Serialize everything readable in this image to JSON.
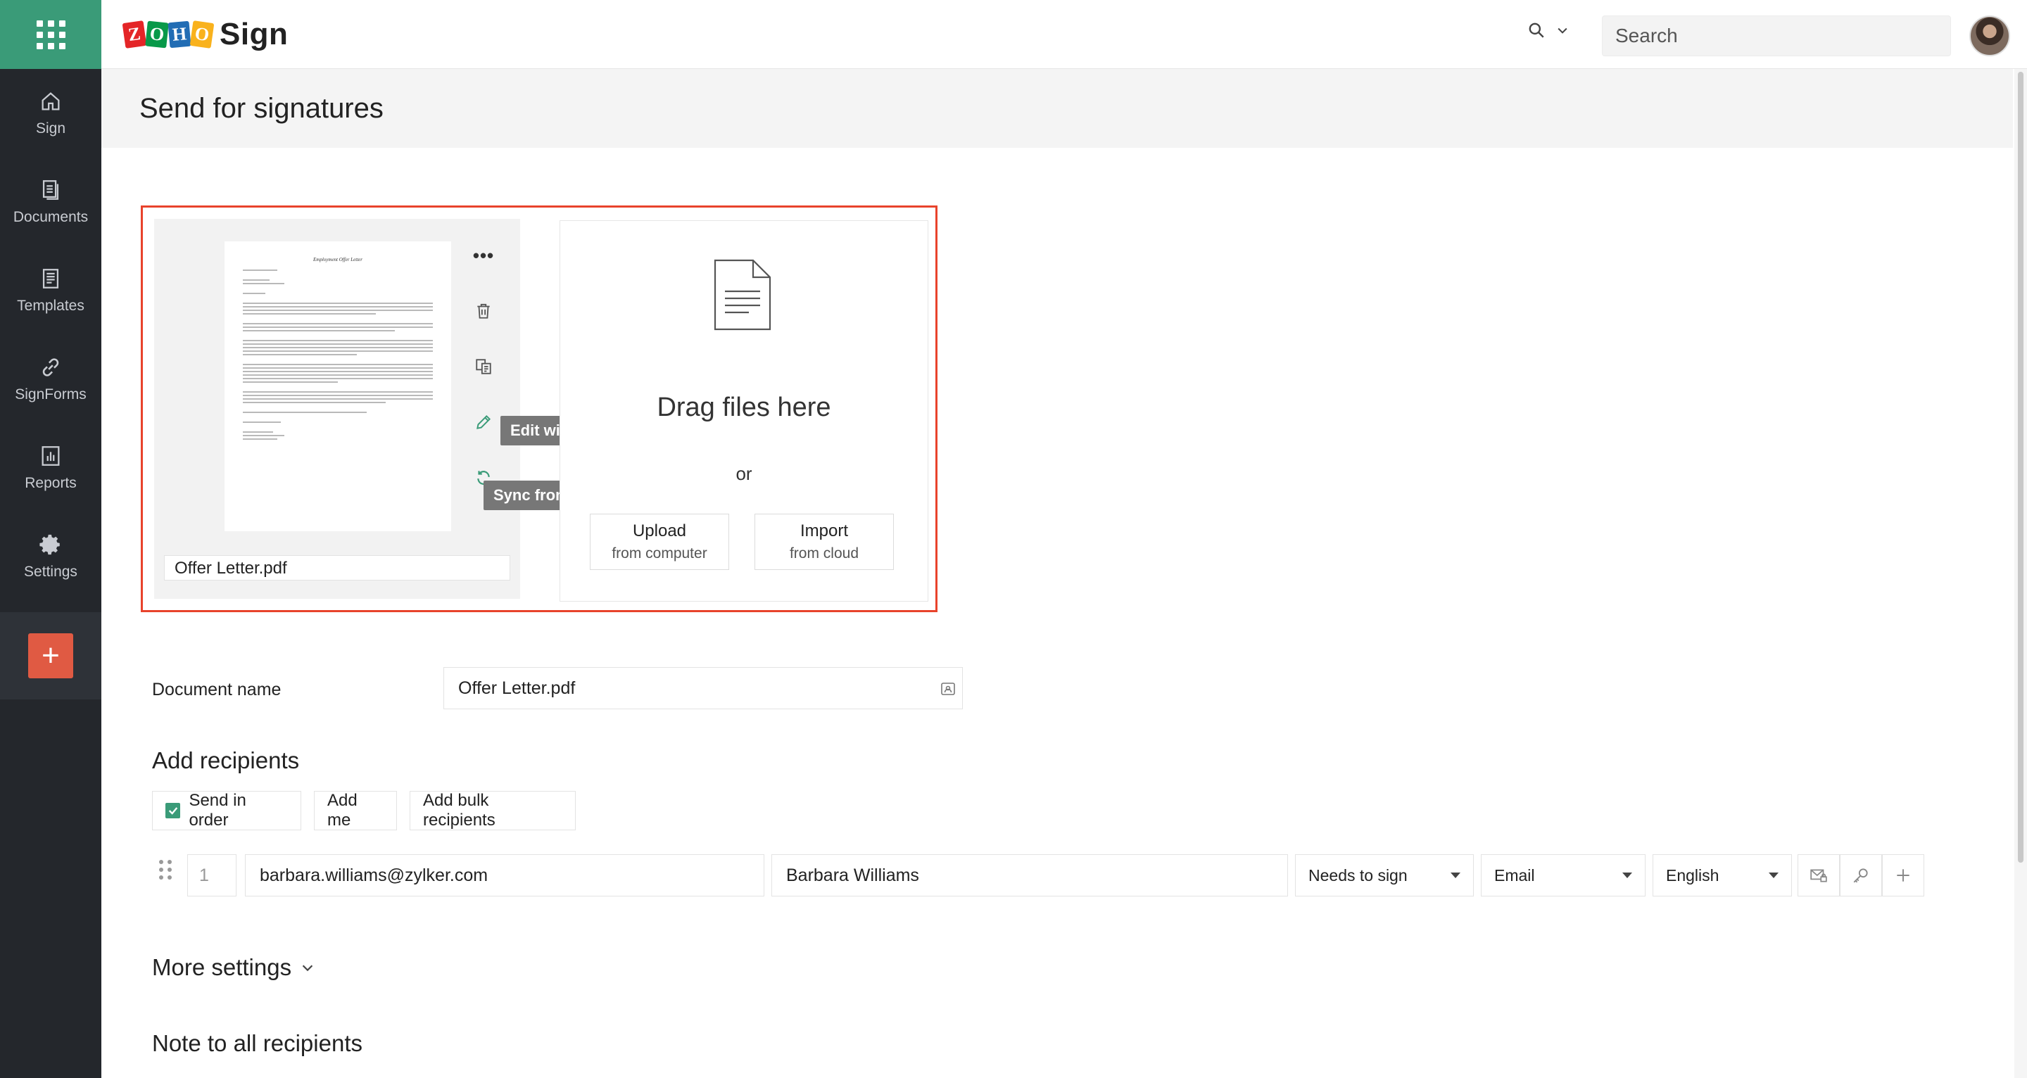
{
  "app": {
    "brand_letters": [
      "Z",
      "O",
      "H",
      "O"
    ],
    "product_name": "Sign"
  },
  "header": {
    "search_placeholder": "Search"
  },
  "sidebar": {
    "items": [
      {
        "label": "Sign",
        "icon": "home-icon"
      },
      {
        "label": "Documents",
        "icon": "documents-icon"
      },
      {
        "label": "Templates",
        "icon": "templates-icon"
      },
      {
        "label": "SignForms",
        "icon": "link-icon"
      },
      {
        "label": "Reports",
        "icon": "reports-icon"
      },
      {
        "label": "Settings",
        "icon": "gear-icon"
      }
    ],
    "create_label": "+"
  },
  "page": {
    "title": "Send for signatures"
  },
  "document": {
    "preview_title": "Employment Offer Letter",
    "file_name": "Offer Letter.pdf",
    "actions": {
      "more": "•••"
    },
    "tooltips": {
      "edit": "Edit with Zoho Writer",
      "sync": "Sync from Zoho WorkDrive"
    }
  },
  "dropzone": {
    "drag_text": "Drag files here",
    "or_text": "or",
    "upload_main": "Upload",
    "upload_sub": "from computer",
    "import_main": "Import",
    "import_sub": "from cloud"
  },
  "document_name": {
    "label": "Document name",
    "value": "Offer Letter.pdf"
  },
  "recipients": {
    "title": "Add recipients",
    "send_in_order_label": "Send in order",
    "send_in_order_checked": true,
    "add_me_label": "Add me",
    "add_bulk_label": "Add bulk recipients",
    "rows": [
      {
        "order": "1",
        "email": "barbara.williams@zylker.com",
        "name": "Barbara Williams",
        "role": "Needs to sign",
        "delivery": "Email",
        "language": "English"
      }
    ]
  },
  "more_settings": {
    "label": "More settings"
  },
  "note": {
    "title": "Note to all recipients"
  },
  "colors": {
    "accent_green": "#3a9b78",
    "sidebar_bg": "#24272c",
    "highlight_red": "#e8432c",
    "create_button": "#e05a43"
  }
}
